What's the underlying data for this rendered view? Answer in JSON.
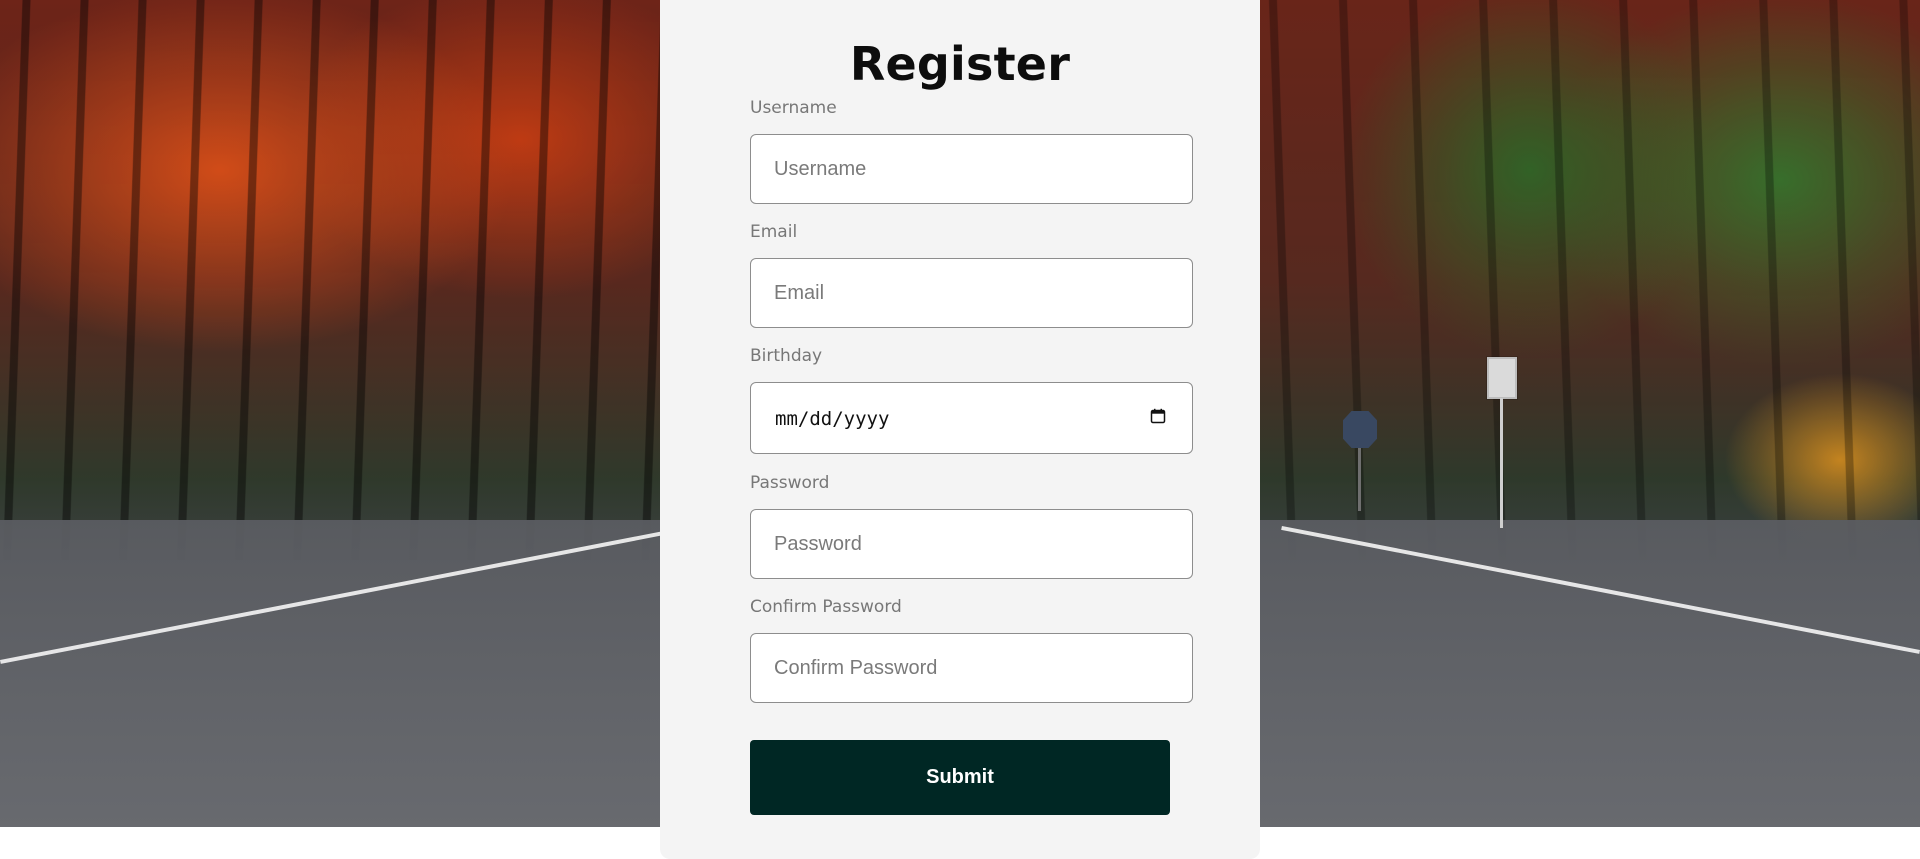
{
  "page": {
    "title": "Register"
  },
  "form": {
    "username": {
      "label": "Username",
      "placeholder": "Username"
    },
    "email": {
      "label": "Email",
      "placeholder": "Email"
    },
    "birthday": {
      "label": "Birthday",
      "value": "mm/dd/yyyy",
      "icon": "calendar-icon"
    },
    "password": {
      "label": "Password",
      "placeholder": "Password"
    },
    "confirm_password": {
      "label": "Confirm Password",
      "placeholder": "Confirm Password"
    },
    "submit_label": "Submit"
  },
  "colors": {
    "panel_background": "#f4f4f4",
    "submit_background": "#002724",
    "label_text": "#777777",
    "field_border": "#8d8d8d"
  }
}
